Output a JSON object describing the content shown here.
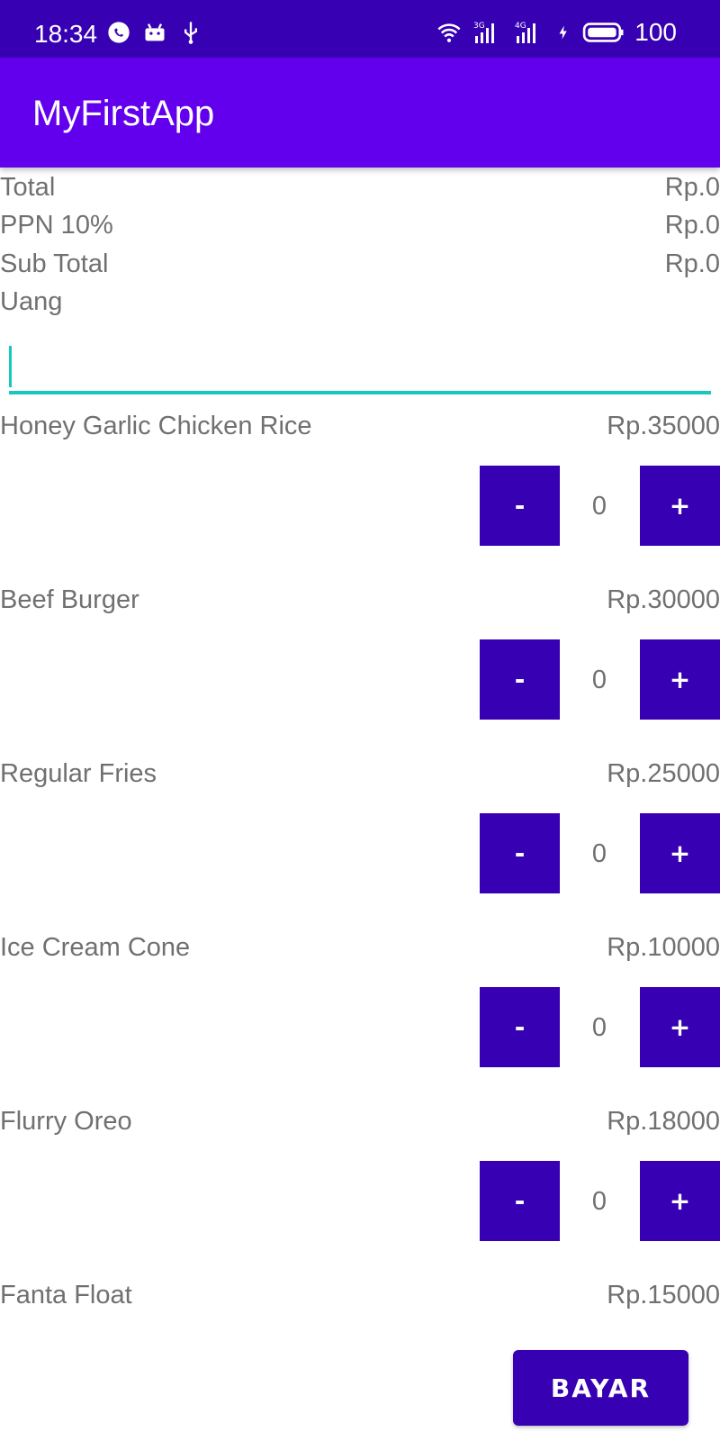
{
  "status_bar": {
    "time": "18:34",
    "battery": "100",
    "network_labels": [
      "3G",
      "4G"
    ],
    "icons_left": [
      "whatsapp-icon",
      "android-icon",
      "usb-icon"
    ],
    "icons_right": [
      "wifi-icon",
      "signal-3g-icon",
      "signal-4g-icon",
      "charging-icon",
      "battery-icon"
    ]
  },
  "app_bar": {
    "title": "MyFirstApp"
  },
  "summary": {
    "total_label": "Total",
    "total_value": "Rp.0",
    "ppn_label": "PPN 10%",
    "ppn_value": "Rp.0",
    "subtotal_label": "Sub Total",
    "subtotal_value": "Rp.0",
    "uang_label": "Uang"
  },
  "money_input": {
    "value": "",
    "placeholder": ""
  },
  "items": [
    {
      "name": "Honey Garlic Chicken Rice",
      "price": "Rp.35000",
      "qty": "0",
      "minus": "-",
      "plus": "+"
    },
    {
      "name": "Beef Burger",
      "price": "Rp.30000",
      "qty": "0",
      "minus": "-",
      "plus": "+"
    },
    {
      "name": "Regular Fries",
      "price": "Rp.25000",
      "qty": "0",
      "minus": "-",
      "plus": "+"
    },
    {
      "name": "Ice Cream Cone",
      "price": "Rp.10000",
      "qty": "0",
      "minus": "-",
      "plus": "+"
    },
    {
      "name": "Flurry Oreo",
      "price": "Rp.18000",
      "qty": "0",
      "minus": "-",
      "plus": "+"
    },
    {
      "name": "Fanta Float",
      "price": "Rp.15000"
    }
  ],
  "pay_button": {
    "label": "BAYAR"
  },
  "colors": {
    "status_bar": "#3700B3",
    "app_bar": "#6200EE",
    "button": "#3700B3",
    "input_underline": "#18C8C0",
    "text": "#707070"
  }
}
